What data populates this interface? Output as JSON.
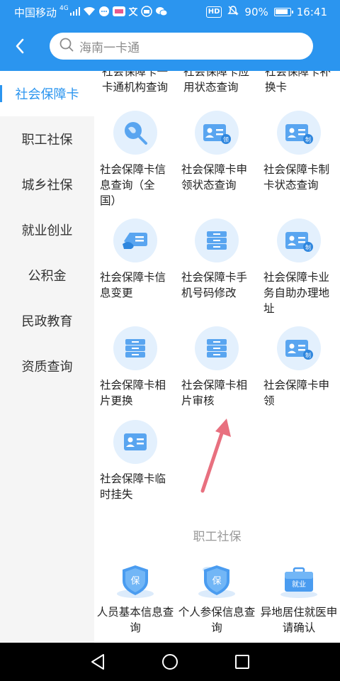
{
  "status": {
    "carrier": "中国移动",
    "net": "4G",
    "battery": "90%",
    "time": "16:41",
    "hd": "HD"
  },
  "search": {
    "placeholder": "海南一卡通"
  },
  "sidebar": {
    "items": [
      {
        "label": "社会保障卡"
      },
      {
        "label": "职工社保"
      },
      {
        "label": "城乡社保"
      },
      {
        "label": "就业创业"
      },
      {
        "label": "公积金"
      },
      {
        "label": "民政教育"
      },
      {
        "label": "资质查询"
      }
    ]
  },
  "content": {
    "top_partial": [
      {
        "label": "社会保障卡一卡通机构查询"
      },
      {
        "label": "社会保障卡应用状态查询"
      },
      {
        "label": "社会保障卡补换卡"
      }
    ],
    "tiles": [
      {
        "label": "社会保障卡信息查询（全国）",
        "icon": "search-globe-icon"
      },
      {
        "label": "社会保障卡申领状态查询",
        "icon": "card-receive-icon"
      },
      {
        "label": "社会保障卡制卡状态查询",
        "icon": "card-make-icon"
      },
      {
        "label": "社会保障卡信息变更",
        "icon": "card-edit-icon"
      },
      {
        "label": "社会保障卡手机号码修改",
        "icon": "server-icon"
      },
      {
        "label": "社会保障卡业务自助办理地址",
        "icon": "card-make-icon"
      },
      {
        "label": "社会保障卡相片更换",
        "icon": "server-icon"
      },
      {
        "label": "社会保障卡相片审核",
        "icon": "server-icon"
      },
      {
        "label": "社会保障卡申领",
        "icon": "card-make-icon"
      },
      {
        "label": "社会保障卡临时挂失",
        "icon": "id-card-icon"
      }
    ],
    "section_title": "职工社保",
    "bottom_tiles": [
      {
        "label": "人员基本信息查询",
        "badge": "保"
      },
      {
        "label": "个人参保信息查询",
        "badge": "保"
      },
      {
        "label": "异地居住就医申请确认",
        "badge": "就业"
      }
    ],
    "badge_texts": {
      "receive": "领",
      "make": "制"
    }
  },
  "colors": {
    "accent": "#2b95ef",
    "icon_bg": "#e3f0fd",
    "arrow": "#e86b7a"
  }
}
